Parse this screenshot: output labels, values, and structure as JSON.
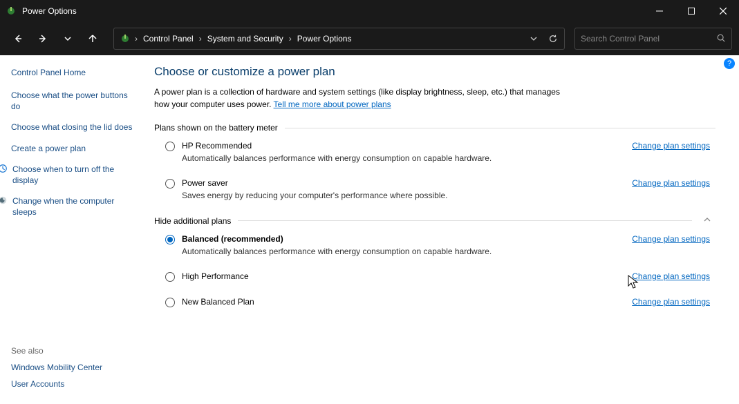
{
  "window": {
    "title": "Power Options"
  },
  "breadcrumbs": {
    "item0": "Control Panel",
    "item1": "System and Security",
    "item2": "Power Options"
  },
  "search": {
    "placeholder": "Search Control Panel"
  },
  "sidebar": {
    "home": "Control Panel Home",
    "links": {
      "l0": "Choose what the power buttons do",
      "l1": "Choose what closing the lid does",
      "l2": "Create a power plan",
      "l3": "Choose when to turn off the display",
      "l4": "Change when the computer sleeps"
    },
    "seealso_label": "See also",
    "seealso": {
      "s0": "Windows Mobility Center",
      "s1": "User Accounts"
    }
  },
  "main": {
    "heading": "Choose or customize a power plan",
    "intro_prefix": "A power plan is a collection of hardware and system settings (like display brightness, sleep, etc.) that manages how your computer uses power. ",
    "intro_link": "Tell me more about power plans",
    "section_battery": "Plans shown on the battery meter",
    "section_hide": "Hide additional plans",
    "change_label": "Change plan settings",
    "plans": {
      "p0": {
        "title": "HP Recommended",
        "desc": "Automatically balances performance with energy consumption on capable hardware."
      },
      "p1": {
        "title": "Power saver",
        "desc": "Saves energy by reducing your computer's performance where possible."
      },
      "p2": {
        "title": "Balanced (recommended)",
        "desc": "Automatically balances performance with energy consumption on capable hardware."
      },
      "p3": {
        "title": "High Performance",
        "desc": ""
      },
      "p4": {
        "title": "New Balanced Plan",
        "desc": ""
      }
    }
  },
  "help_glyph": "?"
}
